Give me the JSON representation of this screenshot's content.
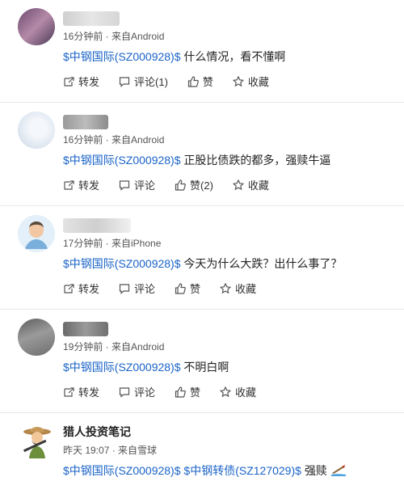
{
  "posts": [
    {
      "meta": "16分钟前 · 来自Android",
      "stock": "$中钢国际(SZ000928)$",
      "text": "什么情况，看不懂啊",
      "actions": {
        "repost": "转发",
        "comment": "评论(1)",
        "like": "赞",
        "favorite": "收藏"
      }
    },
    {
      "meta": "16分钟前 · 来自Android",
      "stock": "$中钢国际(SZ000928)$",
      "text": "正股比债跌的都多，强赎牛逼",
      "actions": {
        "repost": "转发",
        "comment": "评论",
        "like": "赞(2)",
        "favorite": "收藏"
      }
    },
    {
      "meta": "17分钟前 · 来自iPhone",
      "stock": "$中钢国际(SZ000928)$",
      "text": "今天为什么大跌？出什么事了？",
      "actions": {
        "repost": "转发",
        "comment": "评论",
        "like": "赞",
        "favorite": "收藏"
      }
    },
    {
      "meta": "19分钟前 · 来自Android",
      "stock": "$中钢国际(SZ000928)$",
      "text": "不明白啊",
      "actions": {
        "repost": "转发",
        "comment": "评论",
        "like": "赞",
        "favorite": "收藏"
      }
    },
    {
      "name": "猎人投资笔记",
      "meta": "昨天 19:07 · 来自雪球",
      "stock": "$中钢国际(SZ000928)$",
      "stock2": "$中钢转债(SZ127029)$",
      "text": "强赎"
    }
  ],
  "icons": [
    "repost-icon",
    "comment-icon",
    "like-icon",
    "favorite-icon"
  ],
  "colors": {
    "link": "#1a63c7",
    "divider": "#e8e8e8"
  }
}
